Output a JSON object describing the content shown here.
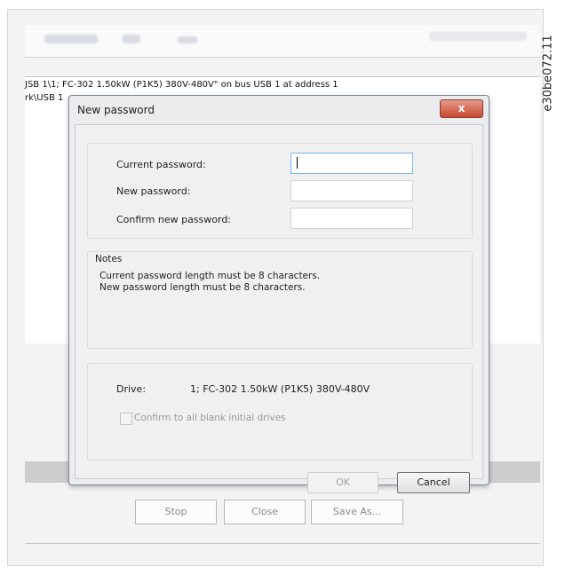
{
  "figure_id": "e30be072.11",
  "background": {
    "line1": "JSB 1\\1; FC-302 1.50kW (P1K5) 380V-480V\" on bus USB 1 at address 1",
    "line2": "rk\\USB 1",
    "buttons": [
      "Stop",
      "Close",
      "Save As..."
    ]
  },
  "dialog": {
    "title": "New password",
    "close_label": "x",
    "fields": [
      {
        "label": "Current password:",
        "value": ""
      },
      {
        "label": "New password:",
        "value": ""
      },
      {
        "label": "Confirm new password:",
        "value": ""
      }
    ],
    "notes": {
      "heading": "Notes",
      "lines": [
        "Current password length must be 8 characters.",
        "New password length must be 8 characters."
      ]
    },
    "drive": {
      "label": "Drive:",
      "value": "1; FC-302 1.50kW (P1K5) 380V-480V",
      "checkbox_label": "Confirm to all blank initial drives",
      "checkbox_checked": false
    },
    "ok_label": "OK",
    "cancel_label": "Cancel"
  }
}
